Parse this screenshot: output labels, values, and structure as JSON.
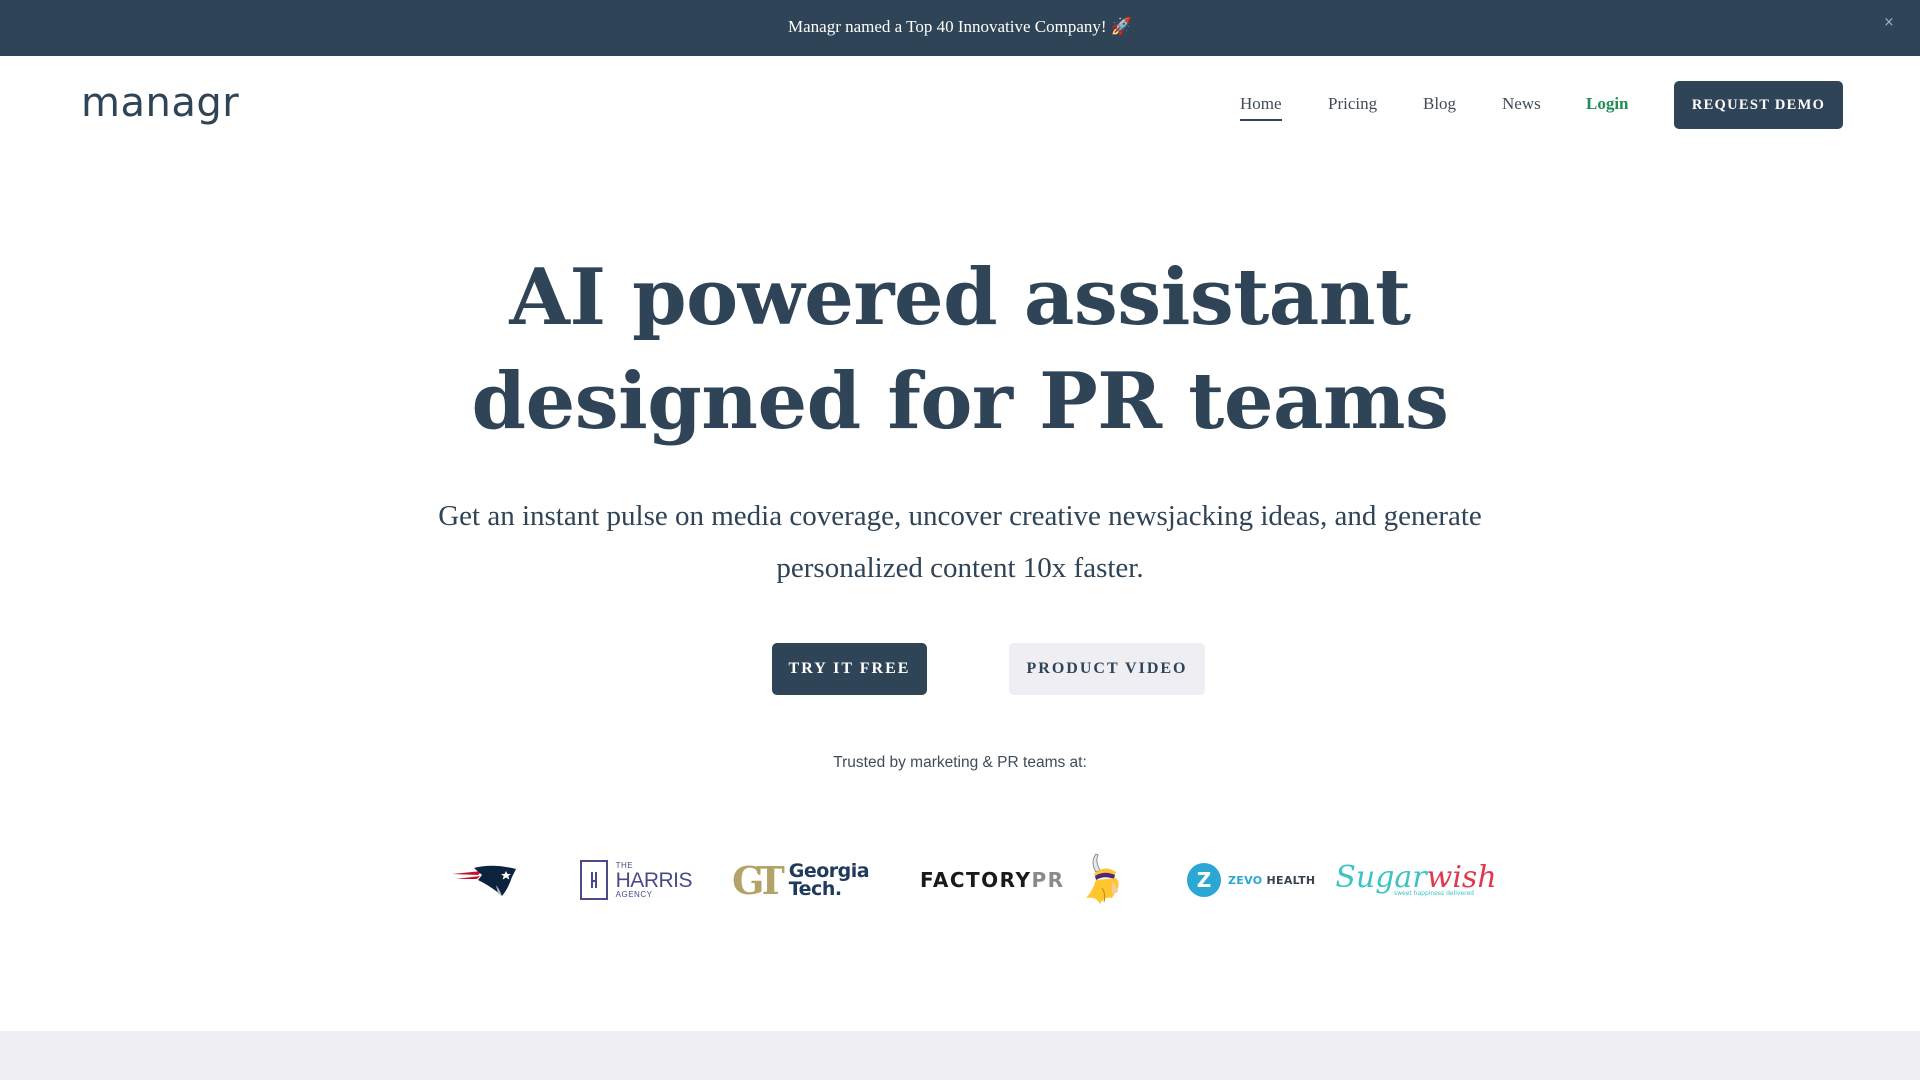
{
  "announcement": {
    "text": "Managr named a Top 40 Innovative Company! 🚀",
    "close_label": "×",
    "close_icon": "close-icon"
  },
  "header": {
    "logo_text": "managr",
    "nav": [
      {
        "label": "Home",
        "active": true
      },
      {
        "label": "Pricing",
        "active": false
      },
      {
        "label": "Blog",
        "active": false
      },
      {
        "label": "News",
        "active": false
      },
      {
        "label": "Login",
        "active": false
      }
    ],
    "cta_label": "REQUEST DEMO"
  },
  "hero": {
    "title_line1": "AI powered assistant",
    "title_line2": "designed for PR teams",
    "subtitle_line1": "Get an instant pulse on media coverage, uncover creative newsjacking ideas, and generate",
    "subtitle_line2": "personalized content 10x faster.",
    "primary_cta": "TRY IT FREE",
    "secondary_cta": "PRODUCT VIDEO"
  },
  "trusted": {
    "label": "Trusted by marketing & PR teams at:",
    "logos": [
      {
        "name": "New England Patriots",
        "icon": "patriots-logo"
      },
      {
        "name": "The Harris Agency",
        "the": "THE",
        "main": "HARRIS",
        "sub": "AGENCY"
      },
      {
        "name": "Georgia Tech",
        "mark": "GT",
        "line1": "Georgia",
        "line2": "Tech."
      },
      {
        "name": "Factory PR",
        "part1": "FACTORY",
        "part2": "PR"
      },
      {
        "name": "Minnesota Vikings",
        "icon": "vikings-logo"
      },
      {
        "name": "Zevo Health",
        "mark": "Z",
        "part1": "ZEVO",
        "part2": " HEALTH"
      },
      {
        "name": "Sugarwish",
        "part1": "Sugar",
        "part2": "wish",
        "tagline": "sweet happiness delivered"
      }
    ]
  },
  "colors": {
    "brand_navy": "#2f4456",
    "login_green": "#1f8f55",
    "secondary_button_bg": "#eeeef3",
    "footer_band": "#efeff4"
  }
}
